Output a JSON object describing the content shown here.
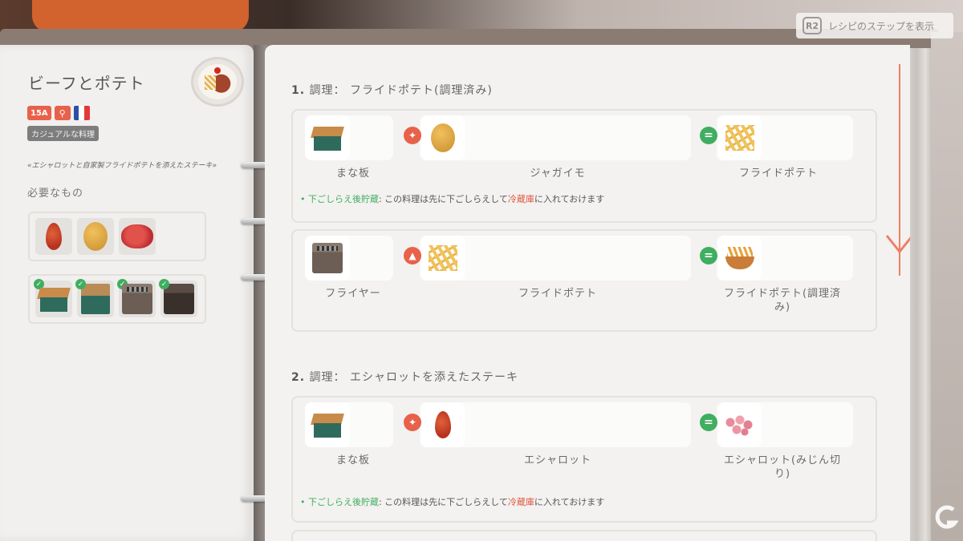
{
  "prompt": {
    "key": "R2",
    "text": "レシピのステップを表示"
  },
  "recipe": {
    "title": "ビーフとポテト",
    "level": "15A",
    "category": "カジュアルな料理",
    "description": "«エシャロットと自家製フライドポテトを添えたステーキ»",
    "needed_label": "必要なもの",
    "flag_colors": [
      "#2d4fa5",
      "#ffffff",
      "#e23a3a"
    ],
    "ingredients": [
      "shallot",
      "potato",
      "meat"
    ],
    "tools": [
      "cutting-board",
      "work-box",
      "fryer",
      "stove"
    ]
  },
  "steps": [
    {
      "header_num": "1.",
      "header_text": "調理： フライドポテト(調理済み)",
      "rows": [
        {
          "tool": "まな板",
          "action": "knife",
          "input": "ジャガイモ",
          "output": "フライドポテト",
          "note": {
            "tag": "• 下ごしらえ後貯蔵",
            "text_a": ": この料理は先に下ごしらえして",
            "highlight": "冷蔵庫",
            "text_b": "に入れておけます"
          }
        },
        {
          "tool": "フライヤー",
          "action": "fire",
          "input": "フライドポテト",
          "output_l1": "フライドポテト(調理済",
          "output_l2": "み)"
        }
      ]
    },
    {
      "header_num": "2.",
      "header_text": "調理： エシャロットを添えたステーキ",
      "rows": [
        {
          "tool": "まな板",
          "action": "knife",
          "input": "エシャロット",
          "output_l1": "エシャロット(みじん切",
          "output_l2": "り)",
          "note": {
            "tag": "• 下ごしらえ後貯蔵",
            "text_a": ": この料理は先に下ごしらえして",
            "highlight": "冷蔵庫",
            "text_b": "に入れておけます"
          }
        }
      ]
    }
  ],
  "colors": {
    "accent": "#e8614b",
    "success": "#3fae60",
    "scroll": "#ef7e67"
  },
  "icons": {
    "knife": "knife-icon",
    "fire": "fire-icon",
    "equals": "equals-icon"
  }
}
